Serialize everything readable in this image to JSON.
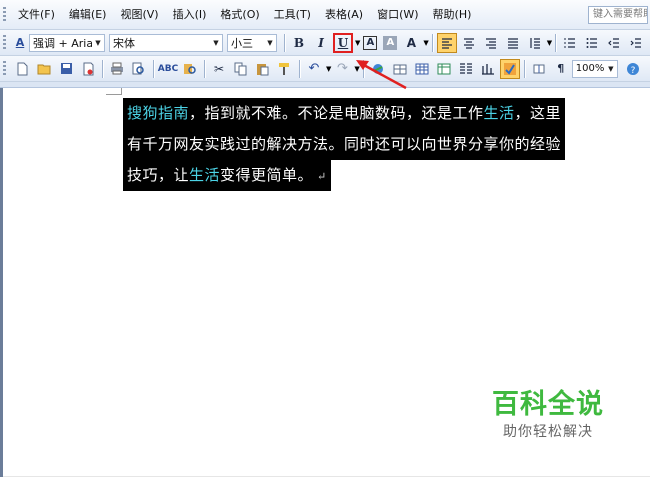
{
  "menubar": {
    "items": [
      "文件(F)",
      "编辑(E)",
      "视图(V)",
      "插入(I)",
      "格式(O)",
      "工具(T)",
      "表格(A)",
      "窗口(W)",
      "帮助(H)"
    ],
    "help_search_placeholder": "键入需要帮助"
  },
  "format_toolbar": {
    "style_icon_glyph": "A",
    "style_value": "强调 + Aria",
    "font_value": "宋体",
    "size_value": "小三",
    "bold_label": "B",
    "italic_label": "I",
    "underline_label": "U",
    "char_border_label": "A",
    "char_shading_label": "A",
    "char_scale_label": "A",
    "zoom_value": "100%"
  },
  "document": {
    "lines": [
      [
        {
          "text": "搜狗指南",
          "accent": true
        },
        {
          "text": "，指到就不难。不论是电脑数码，还是工作",
          "accent": false
        },
        {
          "text": "生活",
          "accent": true
        },
        {
          "text": "，这里",
          "accent": false
        }
      ],
      [
        {
          "text": "有千万网友实践过的解决方法。同时还可以向世界分享你的经验",
          "accent": false
        }
      ],
      [
        {
          "text": "技巧，让",
          "accent": false
        },
        {
          "text": "生活",
          "accent": true
        },
        {
          "text": "变得更简单。",
          "accent": false
        }
      ]
    ],
    "paragraph_mark": "↵"
  },
  "watermark": {
    "title": "百科全说",
    "subtitle": "助你轻松解决"
  },
  "colors": {
    "selection_bg": "#000000",
    "selection_text": "#ffffff",
    "accent_text": "#4cd3e6",
    "annotation_red": "#e02020",
    "watermark_green": "#3fb93f"
  },
  "icons": {
    "standard_toolbar": [
      "new-document-icon",
      "open-folder-icon",
      "save-icon",
      "permission-icon",
      "print-icon",
      "print-preview-icon",
      "spelling-icon",
      "research-icon",
      "cut-icon",
      "copy-icon",
      "paste-icon",
      "format-painter-icon",
      "undo-icon",
      "redo-icon",
      "hyperlink-icon",
      "tables-borders-icon",
      "insert-table-icon",
      "insert-excel-icon",
      "columns-icon",
      "drawing-icon",
      "document-map-icon",
      "show-hide-icon",
      "zoom-icon",
      "help-icon"
    ]
  }
}
